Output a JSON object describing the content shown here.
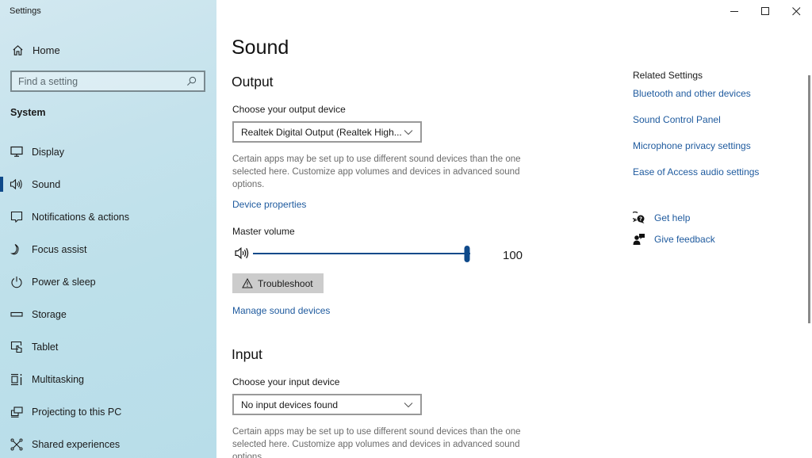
{
  "window": {
    "title": "Settings",
    "controls": {
      "minimize": "minimize",
      "maximize": "maximize",
      "close": "close"
    }
  },
  "sidebar": {
    "home_label": "Home",
    "search_placeholder": "Find a setting",
    "section_label": "System",
    "items": [
      {
        "label": "Display",
        "icon": "monitor-icon",
        "active": false
      },
      {
        "label": "Sound",
        "icon": "speaker-icon",
        "active": true
      },
      {
        "label": "Notifications & actions",
        "icon": "notification-icon",
        "active": false
      },
      {
        "label": "Focus assist",
        "icon": "moon-icon",
        "active": false
      },
      {
        "label": "Power & sleep",
        "icon": "power-icon",
        "active": false
      },
      {
        "label": "Storage",
        "icon": "storage-icon",
        "active": false
      },
      {
        "label": "Tablet",
        "icon": "tablet-icon",
        "active": false
      },
      {
        "label": "Multitasking",
        "icon": "multitasking-icon",
        "active": false
      },
      {
        "label": "Projecting to this PC",
        "icon": "projecting-icon",
        "active": false
      },
      {
        "label": "Shared experiences",
        "icon": "shared-experiences-icon",
        "active": false
      }
    ],
    "accent_color": "#0f4a8a"
  },
  "main": {
    "page_title": "Sound",
    "output": {
      "heading": "Output",
      "device_label": "Choose your output device",
      "device_value": "Realtek Digital Output (Realtek High...",
      "description": "Certain apps may be set up to use different sound devices than the one selected here. Customize app volumes and devices in advanced sound options.",
      "device_properties_link": "Device properties",
      "volume_label": "Master volume",
      "volume_value": "100",
      "volume_fraction": 1.0,
      "troubleshoot_label": "Troubleshoot",
      "manage_link": "Manage sound devices"
    },
    "input": {
      "heading": "Input",
      "device_label": "Choose your input device",
      "device_value": "No input devices found",
      "description": "Certain apps may be set up to use different sound devices than the one selected here. Customize app volumes and devices in advanced sound options."
    }
  },
  "related": {
    "heading": "Related Settings",
    "links": [
      "Bluetooth and other devices",
      "Sound Control Panel",
      "Microphone privacy settings",
      "Ease of Access audio settings"
    ],
    "help": [
      {
        "label": "Get help",
        "icon": "get-help-icon"
      },
      {
        "label": "Give feedback",
        "icon": "feedback-icon"
      }
    ],
    "link_color": "#1e5a9e"
  }
}
